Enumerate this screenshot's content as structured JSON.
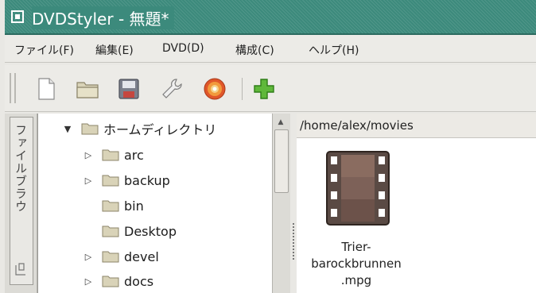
{
  "window": {
    "title": "DVDStyler - 無題*"
  },
  "menu": [
    {
      "label": "ファイル(F)"
    },
    {
      "label": "編集(E)"
    },
    {
      "label": "DVD(D)"
    },
    {
      "label": "構成(C)"
    },
    {
      "label": "ヘルプ(H)"
    }
  ],
  "toolbar": {
    "icons": [
      "new-file-icon",
      "open-folder-icon",
      "save-icon",
      "settings-wrench-icon",
      "burn-disc-icon",
      "add-icon"
    ]
  },
  "sidebar": {
    "tab_label": "ファイルブラウ"
  },
  "tree": {
    "root": "ホームディレクトリ",
    "items": [
      {
        "label": "arc",
        "expandable": true
      },
      {
        "label": "backup",
        "expandable": true
      },
      {
        "label": "bin",
        "expandable": false
      },
      {
        "label": "Desktop",
        "expandable": false
      },
      {
        "label": "devel",
        "expandable": true
      },
      {
        "label": "docs",
        "expandable": true
      }
    ]
  },
  "fileview": {
    "path": "/home/alex/movies",
    "files": [
      {
        "name_lines": [
          "Trier-",
          "barockbrunnen",
          ".mpg"
        ],
        "icon": "video-film-icon"
      }
    ]
  },
  "colors": {
    "titlebar": "#3c8a7c",
    "panel": "#e9e8e4",
    "folder": "#d9d3b8"
  }
}
